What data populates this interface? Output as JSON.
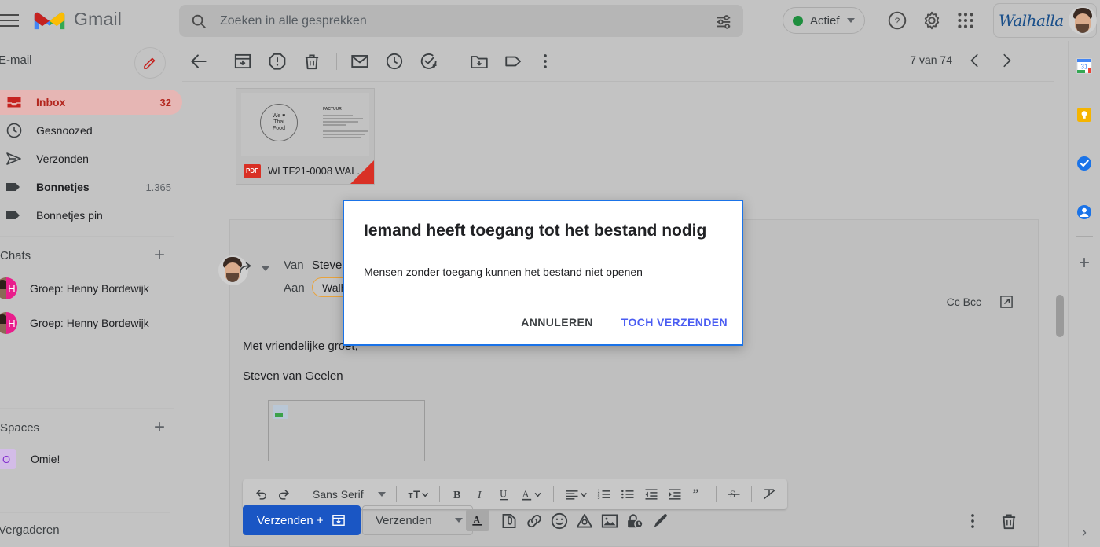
{
  "topbar": {
    "app_name": "Gmail",
    "search": {
      "placeholder": "Zoeken in alle gesprekken",
      "value": ""
    },
    "status": {
      "label": "Actief"
    },
    "brand": "Walhalla"
  },
  "sidebar": {
    "mail_label": "E-mail",
    "nav": [
      {
        "label": "Inbox",
        "count": "32",
        "icon": "inbox-icon",
        "state": "active"
      },
      {
        "label": "Gesnoozed",
        "count": "",
        "icon": "clock-icon",
        "state": ""
      },
      {
        "label": "Verzonden",
        "count": "",
        "icon": "send-icon",
        "state": ""
      },
      {
        "label": "Bonnetjes",
        "count": "1.365",
        "icon": "label-icon",
        "state": "bold"
      },
      {
        "label": "Bonnetjes pin",
        "count": "",
        "icon": "label-icon",
        "state": ""
      }
    ],
    "chats_header": "Chats",
    "chats": [
      {
        "label": "Groep: Henny Bordewijk",
        "initial": "H"
      },
      {
        "label": "Groep: Henny Bordewijk",
        "initial": "H"
      }
    ],
    "spaces_header": "Spaces",
    "spaces": [
      {
        "label": "Omie!",
        "initial": "O"
      }
    ],
    "meet_header": "Vergaderen"
  },
  "message_toolbar": {
    "icons": [
      "back-icon",
      "archive-icon",
      "report-spam-icon",
      "delete-icon",
      "mark-unread-icon",
      "snooze-icon",
      "add-to-tasks-icon",
      "move-to-icon",
      "label-icon",
      "more-options-icon"
    ],
    "pager_count": "7 van 74"
  },
  "attachment": {
    "filename": "WLTF21-0008 WAL...",
    "type_badge": "PDF",
    "thumb_logo_lines": [
      "We ♥",
      "Thai",
      "Food"
    ],
    "thumb_doc_heading": "FACTUUR"
  },
  "compose": {
    "from_label": "Van",
    "from_value": "Steven v",
    "to_label": "Aan",
    "to_chip": "Walhall",
    "cc_bcc": "Cc Bcc",
    "body_lines": [
      "Met vriendelijke groet,",
      "Steven van Geelen"
    ],
    "format_toolbar": {
      "font_name": "Sans Serif",
      "icons": [
        "undo-icon",
        "redo-icon",
        "text-size-icon",
        "bold-icon",
        "italic-icon",
        "underline-icon",
        "text-color-icon",
        "align-icon",
        "numbered-list-icon",
        "bulleted-list-icon",
        "outdent-icon",
        "indent-icon",
        "quote-icon",
        "strikethrough-icon",
        "remove-formatting-icon"
      ]
    },
    "send_archive_label": "Verzenden +",
    "send_label": "Verzenden",
    "action_icons": [
      "formatting-options-icon",
      "attach-file-icon",
      "insert-link-icon",
      "insert-emoji-icon",
      "insert-drive-icon",
      "insert-photo-icon",
      "confidential-mode-icon",
      "signature-icon",
      "more-options-icon",
      "discard-draft-icon"
    ]
  },
  "modal": {
    "title": "Iemand heeft toegang tot het bestand nodig",
    "body": "Mensen zonder toegang kunnen het bestand niet openen",
    "cancel_label": "ANNULEREN",
    "confirm_label": "TOCH VERZENDEN",
    "border_color": "#1a73e8",
    "confirm_color": "#4a5cf2"
  },
  "right_rail": {
    "icons": [
      "google-calendar-icon",
      "google-keep-icon",
      "google-tasks-icon",
      "google-contacts-icon"
    ],
    "add_label": "+",
    "collapse_label": "›"
  }
}
